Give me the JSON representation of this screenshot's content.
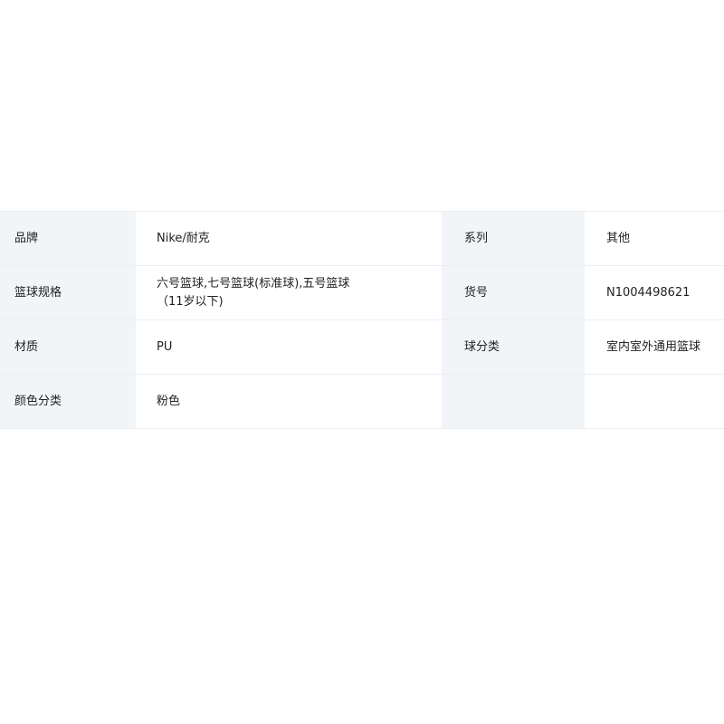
{
  "specs": {
    "rows": [
      {
        "label1": "品牌",
        "value1": "Nike/耐克",
        "label2": "系列",
        "value2": "其他"
      },
      {
        "label1": "篮球规格",
        "value1": "六号篮球,七号篮球(标准球),五号篮球（11岁以下)",
        "label2": "货号",
        "value2": "N1004498621"
      },
      {
        "label1": "材质",
        "value1": "PU",
        "label2": "球分类",
        "value2": "室内室外通用篮球"
      },
      {
        "label1": "颜色分类",
        "value1": "粉色",
        "label2": "",
        "value2": ""
      }
    ]
  }
}
